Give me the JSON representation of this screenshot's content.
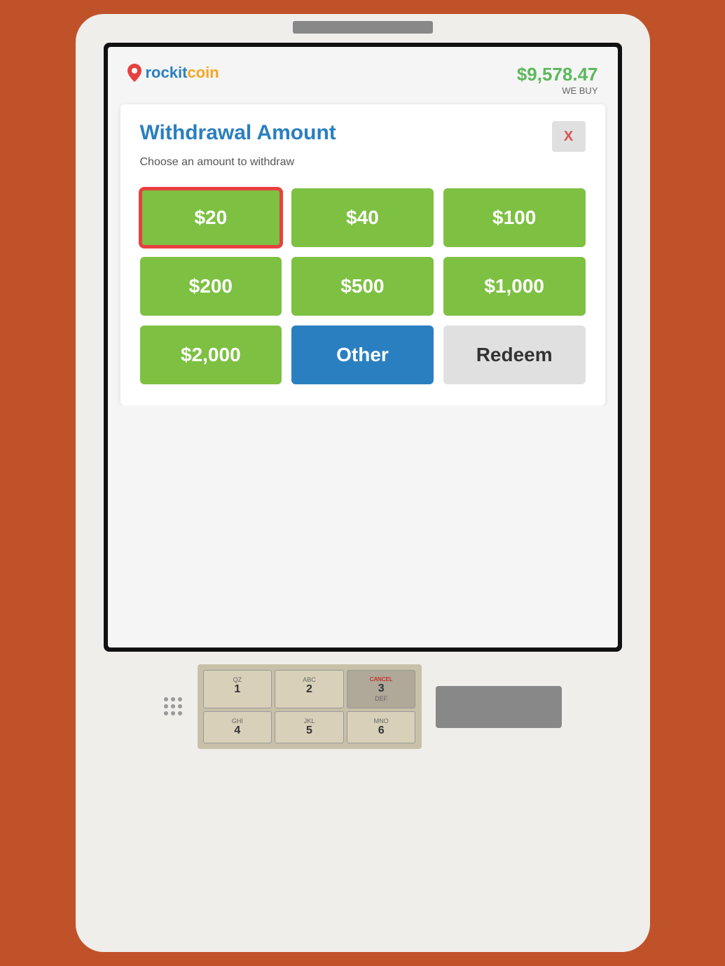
{
  "kiosk": {
    "logo": {
      "text_part1": "rockit",
      "text_part2": "coin"
    },
    "price": {
      "value": "$9,578.47",
      "label": "WE BUY"
    },
    "dialog": {
      "title": "Withdrawal Amount",
      "subtitle": "Choose an amount to withdraw",
      "close_label": "X",
      "amounts": [
        {
          "id": "amt-20",
          "label": "$20",
          "selected": true
        },
        {
          "id": "amt-40",
          "label": "$40",
          "selected": false
        },
        {
          "id": "amt-100",
          "label": "$100",
          "selected": false
        },
        {
          "id": "amt-200",
          "label": "$200",
          "selected": false
        },
        {
          "id": "amt-500",
          "label": "$500",
          "selected": false
        },
        {
          "id": "amt-1000",
          "label": "$1,000",
          "selected": false
        },
        {
          "id": "amt-2000",
          "label": "$2,000",
          "selected": false
        },
        {
          "id": "amt-other",
          "label": "Other",
          "type": "other"
        },
        {
          "id": "amt-redeem",
          "label": "Redeem",
          "type": "redeem"
        }
      ]
    },
    "keypad": {
      "keys": [
        {
          "main": "1",
          "sub": "QZ"
        },
        {
          "main": "2",
          "sub": "ABC"
        },
        {
          "main": "3",
          "sub": "DEF",
          "extra": "CANCEL"
        },
        {
          "main": "4",
          "sub": "GHI"
        },
        {
          "main": "5",
          "sub": "JKL"
        },
        {
          "main": "6",
          "sub": "MNO"
        }
      ],
      "cancel_label": "CANCEL"
    }
  }
}
